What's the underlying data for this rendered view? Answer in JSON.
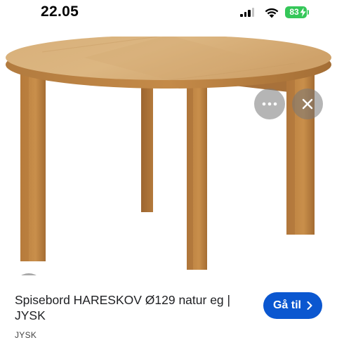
{
  "status_bar": {
    "time": "22.05",
    "battery_level": "83",
    "battery_color": "#35c759",
    "icons": [
      "signal-icon",
      "wifi-icon",
      "battery-icon"
    ]
  },
  "image_controls": {
    "more_icon": "more-horizontal-icon",
    "close_icon": "close-icon",
    "lens_icon": "lens-search-icon"
  },
  "product": {
    "title": "Spisebord HARESKOV Ø129 natur eg | JYSK",
    "source": "JYSK"
  },
  "actions": {
    "goto_label": "Gå til",
    "goto_color": "#0b57d0"
  }
}
